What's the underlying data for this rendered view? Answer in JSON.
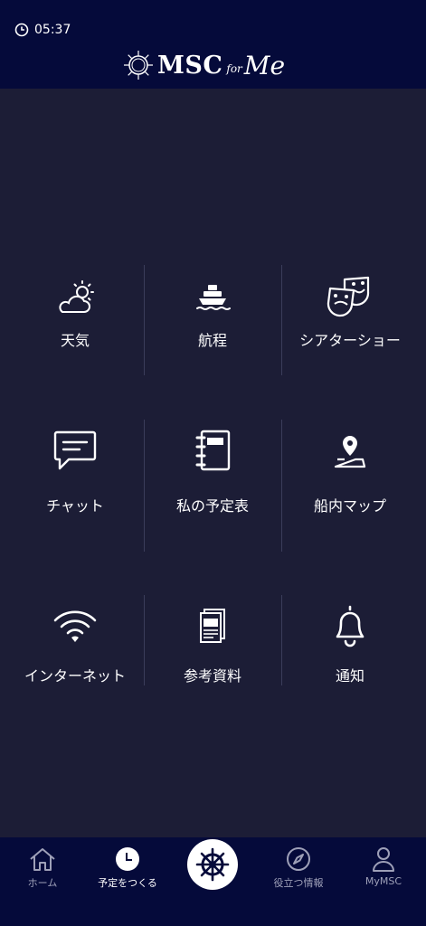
{
  "status": {
    "time": "05:37"
  },
  "logo": {
    "brand": "MSC",
    "for": "for",
    "me": "Me"
  },
  "grid": [
    {
      "label": "天気",
      "icon": "weather-icon"
    },
    {
      "label": "航程",
      "icon": "ship-icon"
    },
    {
      "label": "シアターショー",
      "icon": "theater-masks-icon"
    },
    {
      "label": "チャット",
      "icon": "chat-icon"
    },
    {
      "label": "私の予定表",
      "icon": "notebook-icon"
    },
    {
      "label": "船内マップ",
      "icon": "map-pin-icon"
    },
    {
      "label": "インターネット",
      "icon": "wifi-icon"
    },
    {
      "label": "参考資料",
      "icon": "brochure-icon"
    },
    {
      "label": "通知",
      "icon": "bell-icon"
    }
  ],
  "tabbar": {
    "home": "ホーム",
    "schedule": "予定をつくる",
    "info": "役立つ情報",
    "mymsc": "MyMSC"
  }
}
